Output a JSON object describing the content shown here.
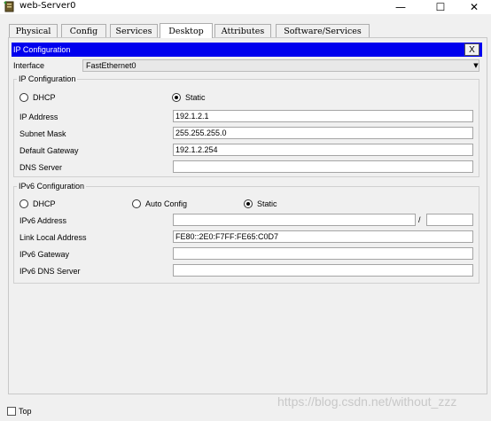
{
  "window": {
    "title": "web-Server0",
    "icon": "server-icon",
    "minimize_glyph": "—",
    "maximize_glyph": "☐",
    "close_glyph": "✕"
  },
  "tabs": [
    {
      "label": "Physical",
      "active": false
    },
    {
      "label": "Config",
      "active": false
    },
    {
      "label": "Services",
      "active": false
    },
    {
      "label": "Desktop",
      "active": true
    },
    {
      "label": "Attributes",
      "active": false
    },
    {
      "label": "Software/Services",
      "active": false
    }
  ],
  "panel": {
    "title": "IP Configuration",
    "close_label": "X",
    "header_color": "#0000ee"
  },
  "interface": {
    "label": "Interface",
    "value": "FastEthernet0",
    "arrow": "▼"
  },
  "ipv4": {
    "group_title": "IP Configuration",
    "dhcp_label": "DHCP",
    "static_label": "Static",
    "mode": "static",
    "fields": {
      "ip_address": {
        "label": "IP Address",
        "value": "192.1.2.1"
      },
      "subnet_mask": {
        "label": "Subnet Mask",
        "value": "255.255.255.0"
      },
      "default_gateway": {
        "label": "Default Gateway",
        "value": "192.1.2.254"
      },
      "dns_server": {
        "label": "DNS Server",
        "value": ""
      }
    }
  },
  "ipv6": {
    "group_title": "IPv6 Configuration",
    "dhcp_label": "DHCP",
    "auto_label": "Auto Config",
    "static_label": "Static",
    "mode": "static",
    "fields": {
      "ipv6_address": {
        "label": "IPv6 Address",
        "value": "",
        "prefix": ""
      },
      "link_local": {
        "label": "Link Local Address",
        "value": "FE80::2E0:F7FF:FE65:C0D7"
      },
      "gateway": {
        "label": "IPv6 Gateway",
        "value": ""
      },
      "dns_server": {
        "label": "IPv6 DNS Server",
        "value": ""
      }
    },
    "slash": "/"
  },
  "bottom": {
    "top_label": "Top",
    "top_checked": false,
    "watermark": "https://blog.csdn.net/without_zzz"
  }
}
